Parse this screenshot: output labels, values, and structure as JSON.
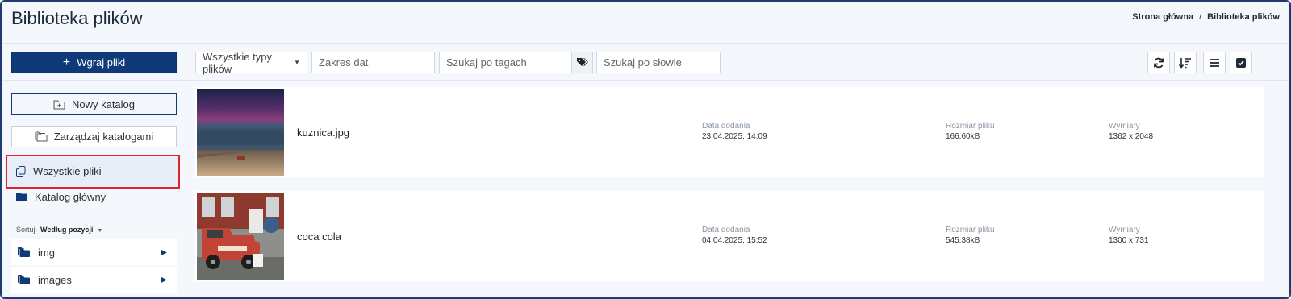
{
  "header": {
    "title": "Biblioteka plików",
    "breadcrumb": [
      "Strona główna",
      "Biblioteka plików"
    ]
  },
  "toolbar": {
    "upload_label": "Wgraj pliki",
    "type_filter": "Wszystkie typy plików",
    "date_placeholder": "Zakres dat",
    "tags_placeholder": "Szukaj po tagach",
    "word_placeholder": "Szukaj po słowie",
    "tools": [
      "refresh-icon",
      "sort-icon",
      "list-view-icon",
      "select-all-icon"
    ]
  },
  "sidebar": {
    "new_folder": "Nowy katalog",
    "manage_folders": "Zarządzaj katalogami",
    "all_files": "Wszystkie pliki",
    "root_folder": "Katalog główny",
    "sort_label": "Sortuj:",
    "sort_value": "Według pozycji",
    "folders": [
      {
        "label": "img"
      },
      {
        "label": "images"
      }
    ]
  },
  "files": [
    {
      "name": "kuznica.jpg",
      "date_label": "Data dodania",
      "date": "23.04.2025, 14:09",
      "size_label": "Rozmiar pliku",
      "size": "166.60kB",
      "dims_label": "Wymiary",
      "dims": "1362 x 2048"
    },
    {
      "name": "coca cola",
      "date_label": "Data dodania",
      "date": "04.04.2025, 15:52",
      "size_label": "Rozmiar pliku",
      "size": "545.38kB",
      "dims_label": "Wymiary",
      "dims": "1300 x 731"
    }
  ],
  "colors": {
    "primary": "#10397a",
    "highlight_border": "#e0242a",
    "panel_bg": "#f4f7fb"
  }
}
